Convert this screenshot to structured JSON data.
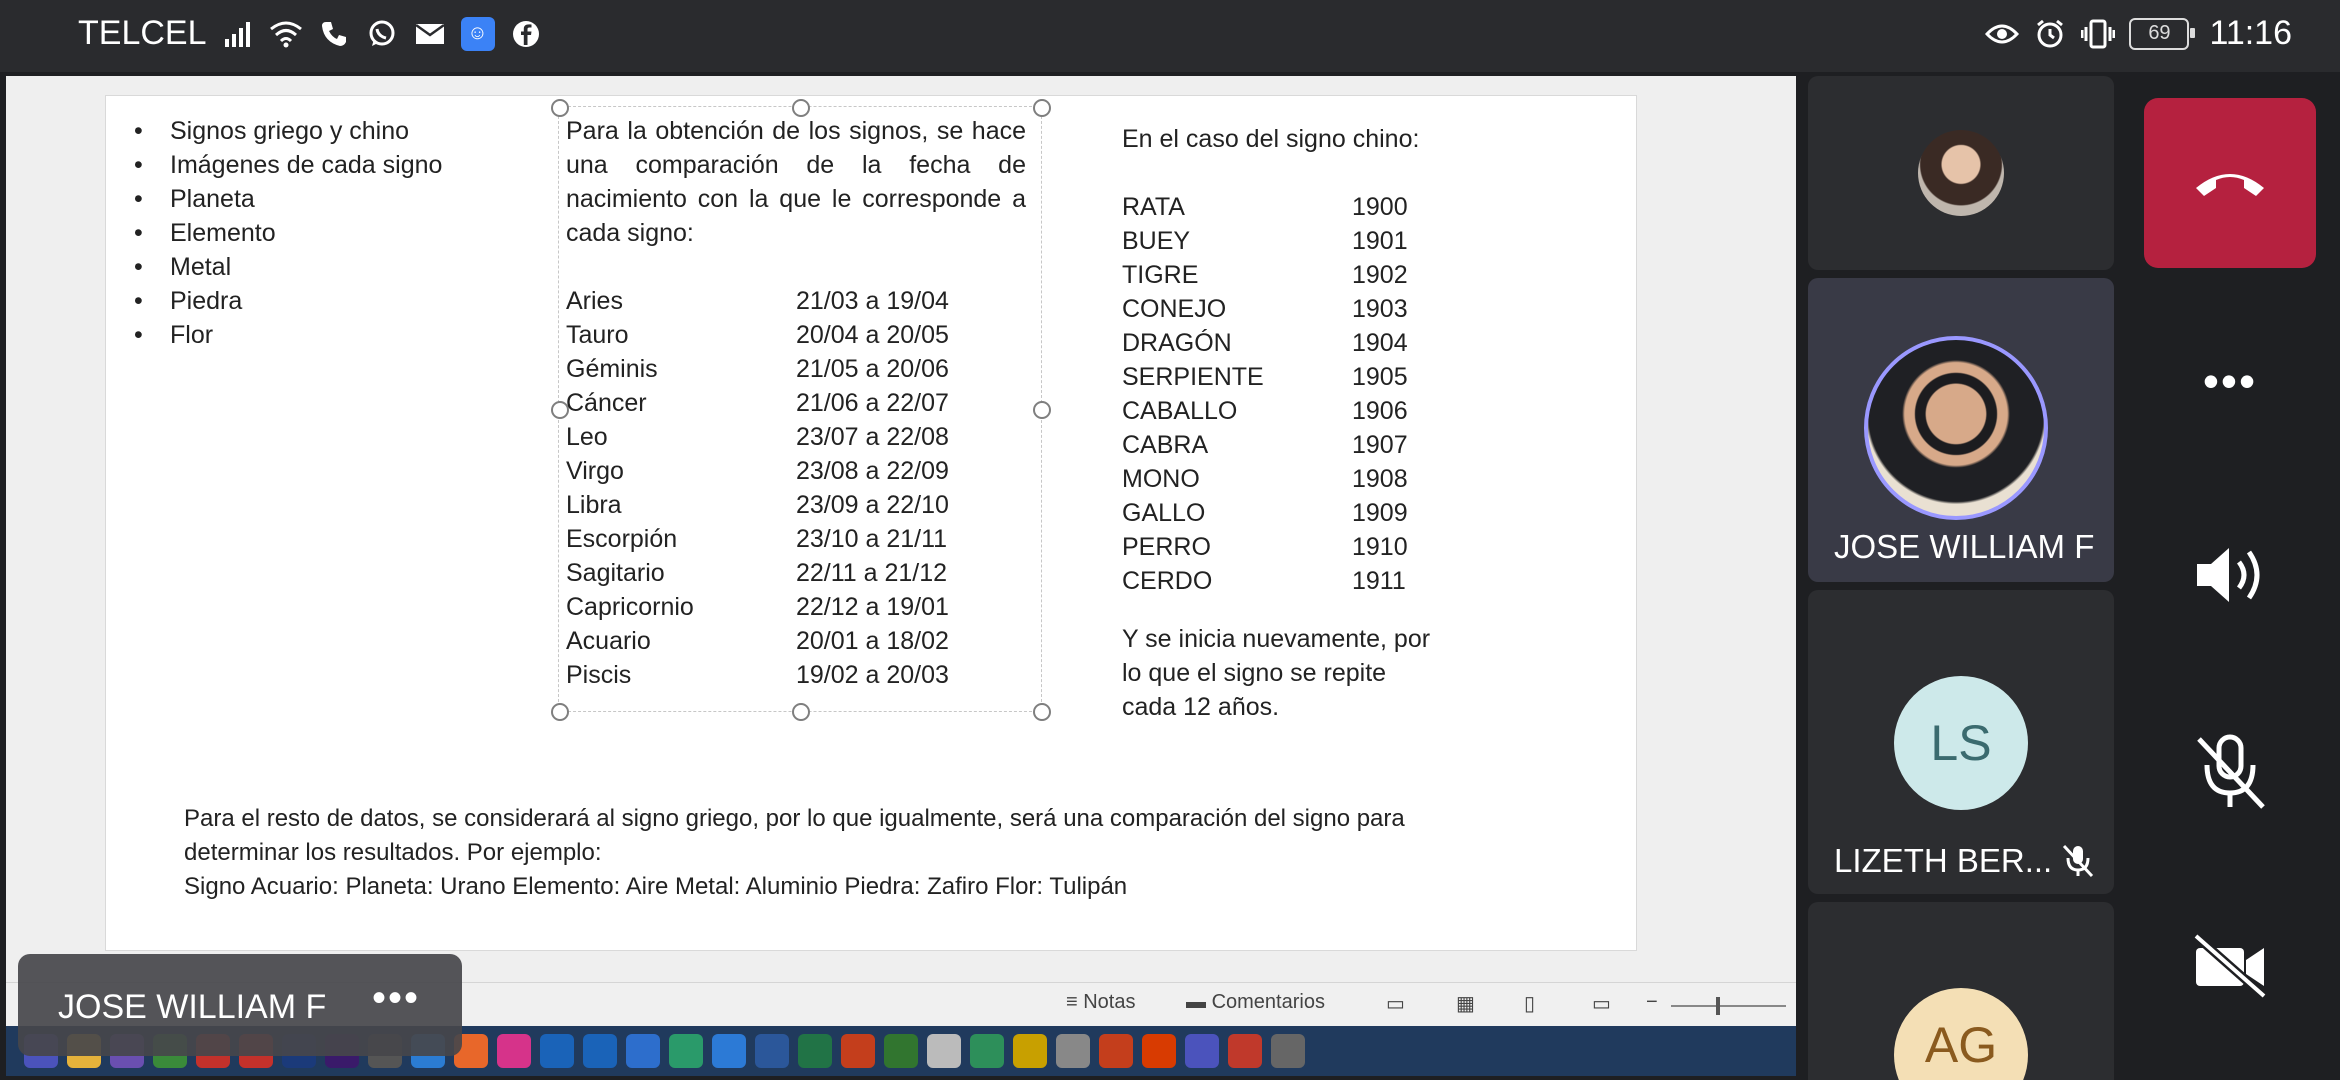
{
  "status_bar": {
    "carrier": "TELCEL",
    "time": "11:16",
    "battery": "69",
    "left_icons": [
      "signal-icon",
      "wifi-icon",
      "phone-icon",
      "whatsapp-icon",
      "mail-icon",
      "app-icon",
      "facebook-icon"
    ],
    "right_icons": [
      "eye-icon",
      "alarm-icon",
      "vibrate-icon",
      "battery-icon"
    ]
  },
  "slide": {
    "bullets": [
      "Signos griego y chino",
      "Imágenes de cada signo",
      "Planeta",
      "Elemento",
      "Metal",
      "Piedra",
      "Flor"
    ],
    "intro": "Para la obtención de los signos, se hace una comparación de la fecha de nacimiento con la que le corresponde a cada signo:",
    "zodiac": [
      {
        "sign": "Aries",
        "range": "21/03 a 19/04"
      },
      {
        "sign": "Tauro",
        "range": "20/04 a 20/05"
      },
      {
        "sign": "Géminis",
        "range": "21/05 a 20/06"
      },
      {
        "sign": "Cáncer",
        "range": "21/06 a 22/07"
      },
      {
        "sign": "Leo",
        "range": "23/07 a 22/08"
      },
      {
        "sign": "Virgo",
        "range": "23/08 a 22/09"
      },
      {
        "sign": "Libra",
        "range": "23/09 a 22/10"
      },
      {
        "sign": "Escorpión",
        "range": "23/10 a 21/11"
      },
      {
        "sign": "Sagitario",
        "range": "22/11 a 21/12"
      },
      {
        "sign": "Capricornio",
        "range": "22/12 a 19/01"
      },
      {
        "sign": "Acuario",
        "range": "20/01 a 18/02"
      },
      {
        "sign": "Piscis",
        "range": "19/02 a 20/03"
      }
    ],
    "chinese_heading": "En el caso del signo chino:",
    "chinese": [
      {
        "sign": "RATA",
        "year": "1900"
      },
      {
        "sign": "BUEY",
        "year": "1901"
      },
      {
        "sign": "TIGRE",
        "year": "1902"
      },
      {
        "sign": "CONEJO",
        "year": "1903"
      },
      {
        "sign": "DRAGÓN",
        "year": "1904"
      },
      {
        "sign": "SERPIENTE",
        "year": "1905"
      },
      {
        "sign": "CABALLO",
        "year": "1906"
      },
      {
        "sign": "CABRA",
        "year": "1907"
      },
      {
        "sign": "MONO",
        "year": "1908"
      },
      {
        "sign": "GALLO",
        "year": "1909"
      },
      {
        "sign": "PERRO",
        "year": "1910"
      },
      {
        "sign": "CERDO",
        "year": "1911"
      }
    ],
    "chinese_note": [
      "Y se inicia nuevamente, por",
      "lo que el signo se repite",
      "cada 12 años."
    ],
    "footer_lines": [
      "Para el resto de datos, se considerará al signo griego, por lo que igualmente, será una comparación del signo para",
      "determinar los resultados. Por ejemplo:",
      "Signo Acuario: Planeta: Urano  Elemento: Aire  Metal: Aluminio   Piedra: Zafiro   Flor: Tulipán"
    ]
  },
  "powerpoint_bar": {
    "notes_label": "Notas",
    "comments_label": "Comentarios"
  },
  "presenter": {
    "name": "JOSE WILLIAM F",
    "more": "•••"
  },
  "participants": [
    {
      "name": "",
      "initials": "",
      "muted": false
    },
    {
      "name": "JOSE WILLIAM F",
      "initials": "",
      "speaking": true
    },
    {
      "name": "LIZETH BER...",
      "initials": "LS",
      "muted": true
    },
    {
      "name": "",
      "initials": "AG",
      "muted": false
    }
  ],
  "controls": {
    "more_label": "•••"
  },
  "colors": {
    "end_call": "#b5213f",
    "speaking_ring": "#9a98ff",
    "ls_avatar": "#cde9ea",
    "ag_avatar": "#f4dfb5"
  },
  "taskbar_icons": [
    "teams",
    "explorer",
    "app",
    "minecraft",
    "acrobat",
    "acrobat-2",
    "photoshop",
    "premiere",
    "calculator",
    "notes",
    "brave",
    "itunes",
    "outlook",
    "edge",
    "box",
    "grammarly",
    "vscode",
    "word",
    "excel",
    "powerpoint",
    "project",
    "chrome",
    "edge-2",
    "store",
    "mic",
    "ppt-2",
    "office",
    "teams-2",
    "gimp",
    "desktop"
  ]
}
